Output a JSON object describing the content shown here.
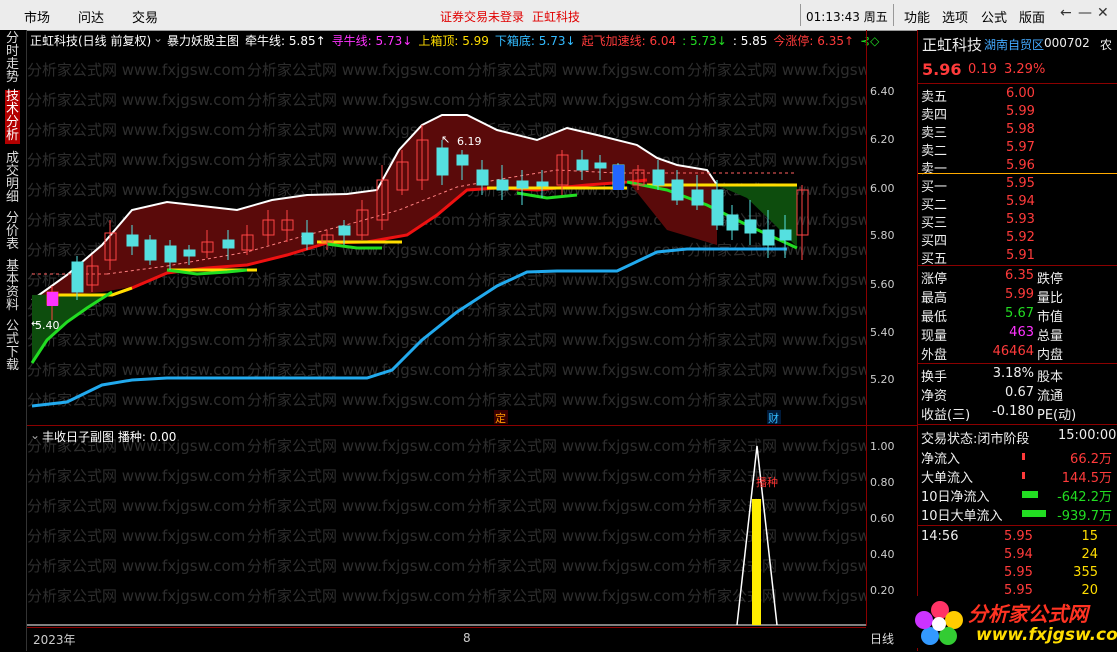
{
  "topbar": {
    "menus": [
      "市场",
      "问达",
      "交易"
    ],
    "notice": "证券交易未登录",
    "notice_stock": "正虹科技",
    "clock": "01:13:43",
    "weekday": "周五",
    "right_menus": [
      "功能",
      "选项",
      "公式",
      "版面"
    ],
    "window_controls": [
      "←",
      "—",
      "✕"
    ]
  },
  "left_tabs": [
    {
      "label": "分时走势",
      "active": false
    },
    {
      "label": "技术分析",
      "active": true
    },
    {
      "label": "成交明细",
      "active": false
    },
    {
      "label": "分价表",
      "active": false
    },
    {
      "label": "基本资料",
      "active": false
    },
    {
      "label": "公式下载",
      "active": false
    }
  ],
  "main_header": {
    "title": "正虹科技(日线 前复权)",
    "formula": "暴力妖股主图",
    "items": [
      {
        "label": "牵牛线:",
        "value": "5.85",
        "arrow": "↑",
        "color": "#ffffff"
      },
      {
        "label": "寻牛线:",
        "value": "5.73",
        "arrow": "↓",
        "color": "#ff33ff"
      },
      {
        "label": "上箱顶:",
        "value": "5.99",
        "arrow": "",
        "color": "#ffdd00"
      },
      {
        "label": "下箱底:",
        "value": "5.73",
        "arrow": "↓",
        "color": "#33bbff"
      },
      {
        "label": "起飞加速线:",
        "value": "6.04",
        "arrow": "",
        "color": "#ff3b3b"
      },
      {
        "label": ":",
        "value": "5.73",
        "arrow": "↓",
        "color": "#22dd22"
      },
      {
        "label": ":",
        "value": "5.85",
        "arrow": "",
        "color": "#ffffff"
      },
      {
        "label": "今涨停:",
        "value": "6.35",
        "arrow": "↑",
        "color": "#ff3b3b"
      }
    ]
  },
  "main_axis": [
    "6.40",
    "6.20",
    "6.00",
    "5.80",
    "5.60",
    "5.40",
    "5.20"
  ],
  "main_annotations": {
    "high_label": "6.19",
    "low_label": "5.40",
    "marker_ding": "定",
    "marker_cai": "财"
  },
  "sub_header": {
    "title": "丰收日子副图",
    "label": "播种:",
    "value": "0.00",
    "signal": "播种"
  },
  "sub_axis": [
    "1.00",
    "0.80",
    "0.60",
    "0.40",
    "0.20"
  ],
  "bottom_axis": {
    "year": "2023年",
    "month": "8",
    "period": "日线"
  },
  "quote": {
    "name": "正虹科技",
    "sector": "湖南自贸区",
    "code": "000702",
    "tag": "农",
    "price": "5.96",
    "change": "0.19",
    "change_pct": "3.29%",
    "sell": [
      {
        "label": "卖五",
        "price": "6.00"
      },
      {
        "label": "卖四",
        "price": "5.99"
      },
      {
        "label": "卖三",
        "price": "5.98"
      },
      {
        "label": "卖二",
        "price": "5.97"
      },
      {
        "label": "卖一",
        "price": "5.96"
      }
    ],
    "buy": [
      {
        "label": "买一",
        "price": "5.95"
      },
      {
        "label": "买二",
        "price": "5.94"
      },
      {
        "label": "买三",
        "price": "5.93"
      },
      {
        "label": "买四",
        "price": "5.92"
      },
      {
        "label": "买五",
        "price": "5.91"
      }
    ],
    "stats": [
      {
        "label": "涨停",
        "value": "6.35",
        "label2": "跌停"
      },
      {
        "label": "最高",
        "value": "5.99",
        "label2": "量比"
      },
      {
        "label": "最低",
        "value": "5.67",
        "label2": "市值"
      },
      {
        "label": "现量",
        "value": "463",
        "label2": "总量"
      },
      {
        "label": "外盘",
        "value": "46464",
        "label2": "内盘"
      }
    ],
    "stats2": [
      {
        "label": "换手",
        "value": "3.18%",
        "label2": "股本"
      },
      {
        "label": "净资",
        "value": "0.67",
        "label2": "流通"
      },
      {
        "label": "收益(三)",
        "value": "-0.180",
        "label2": "PE(动)"
      }
    ],
    "status": {
      "label": "交易状态:",
      "value": "闭市阶段",
      "time": "15:00:00"
    },
    "flows": [
      {
        "label": "净流入",
        "value": "66.2万",
        "color": "#ff3b3b"
      },
      {
        "label": "大单流入",
        "value": "144.5万",
        "color": "#ff3b3b"
      },
      {
        "label": "10日净流入",
        "value": "-642.2万",
        "color": "#22dd22"
      },
      {
        "label": "10日大单流入",
        "value": "-939.7万",
        "color": "#22dd22"
      }
    ],
    "ticks": [
      {
        "time": "14:56",
        "price": "5.95",
        "vol": "15"
      },
      {
        "time": "",
        "price": "5.94",
        "vol": "24"
      },
      {
        "time": "",
        "price": "5.95",
        "vol": "355"
      },
      {
        "time": "",
        "price": "5.95",
        "vol": "20"
      }
    ]
  },
  "watermark": "分析家公式网 www.fxjgsw.com",
  "logo": {
    "text": "分析家公式网",
    "url": "www.fxjgsw.com"
  },
  "colors": {
    "up": "#ff3b3b",
    "down": "#22dd22",
    "bg": "#000000",
    "grid": "#8b0000",
    "box": "#6b0d0d"
  }
}
